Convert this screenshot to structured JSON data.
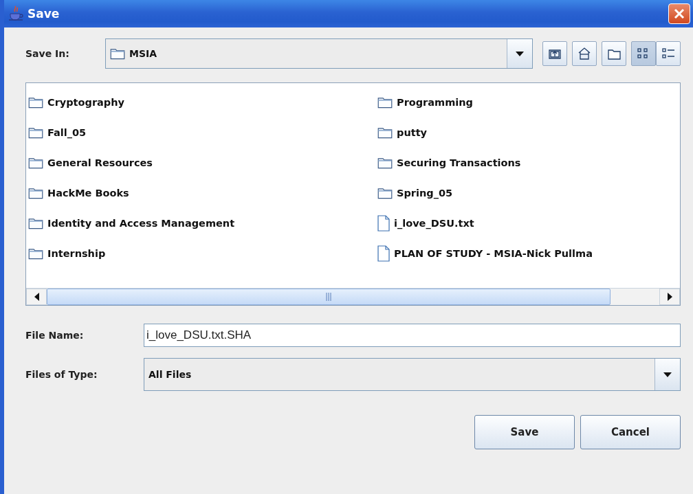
{
  "window": {
    "title": "Save"
  },
  "save_in": {
    "label": "Save In:",
    "value": "MSIA"
  },
  "toolbar": [
    {
      "kind": "up",
      "selected": false
    },
    {
      "kind": "home",
      "selected": false
    },
    {
      "kind": "new-folder",
      "selected": false
    },
    {
      "kind": "list",
      "selected": true
    },
    {
      "kind": "details",
      "selected": false
    }
  ],
  "files": [
    {
      "name": "Cryptography",
      "kind": "folder"
    },
    {
      "name": "Fall_05",
      "kind": "folder"
    },
    {
      "name": "General Resources",
      "kind": "folder"
    },
    {
      "name": "HackMe Books",
      "kind": "folder"
    },
    {
      "name": "Identity and Access Management",
      "kind": "folder"
    },
    {
      "name": "Internship",
      "kind": "folder"
    },
    {
      "name": "Programming",
      "kind": "folder"
    },
    {
      "name": "putty",
      "kind": "folder"
    },
    {
      "name": "Securing Transactions",
      "kind": "folder"
    },
    {
      "name": "Spring_05",
      "kind": "folder"
    },
    {
      "name": "i_love_DSU.txt",
      "kind": "file"
    },
    {
      "name": "PLAN OF STUDY - MSIA-Nick Pullma",
      "kind": "file"
    }
  ],
  "file_name": {
    "label": "File Name:",
    "value": "i_love_DSU.txt.SHA"
  },
  "file_type": {
    "label": "Files of Type:",
    "value": "All Files"
  },
  "buttons": [
    "Save",
    "Cancel"
  ]
}
